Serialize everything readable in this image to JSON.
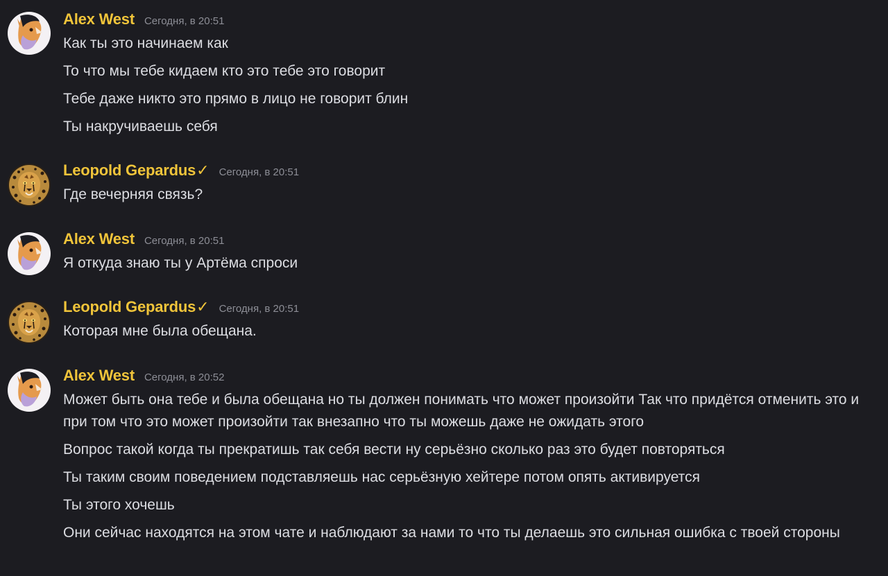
{
  "colors": {
    "background": "#1c1c21",
    "username": "#f0c43a",
    "timestamp": "#8d8e96",
    "text": "#dcdde2"
  },
  "messages": [
    {
      "author": "Alex West",
      "verified": false,
      "avatar_icon": "fox-avatar-icon",
      "timestamp": "Сегодня, в 20:51",
      "lines": [
        "Как ты это начинаем как",
        "То что мы тебе кидаем кто это тебе это говорит",
        "Тебе даже никто это прямо в лицо не говорит блин",
        "Ты накручиваешь себя"
      ]
    },
    {
      "author": "Leopold Gepardus",
      "verified": true,
      "verified_mark": "✓",
      "avatar_icon": "cheetah-avatar-icon",
      "timestamp": "Сегодня, в 20:51",
      "lines": [
        "Где вечерняя связь?"
      ]
    },
    {
      "author": "Alex West",
      "verified": false,
      "avatar_icon": "fox-avatar-icon",
      "timestamp": "Сегодня, в 20:51",
      "lines": [
        "Я откуда знаю ты у Артёма спроси"
      ]
    },
    {
      "author": "Leopold Gepardus",
      "verified": true,
      "verified_mark": "✓",
      "avatar_icon": "cheetah-avatar-icon",
      "timestamp": "Сегодня, в 20:51",
      "lines": [
        "Которая мне была обещана."
      ]
    },
    {
      "author": "Alex West",
      "verified": false,
      "avatar_icon": "fox-avatar-icon",
      "timestamp": "Сегодня, в 20:52",
      "lines": [
        "Может быть она тебе и была обещана но ты должен понимать что может произойти Так что придётся отменить это и при том что это может произойти так внезапно что ты можешь даже не ожидать этого",
        "Вопрос такой когда ты прекратишь так себя вести ну серьёзно сколько раз это будет повторяться",
        "Ты таким своим поведением подставляешь нас серьёзную хейтере потом опять активируется",
        "Ты этого хочешь",
        "Они сейчас находятся на этом чате и наблюдают за нами то что ты делаешь это сильная ошибка с твоей стороны"
      ]
    }
  ]
}
